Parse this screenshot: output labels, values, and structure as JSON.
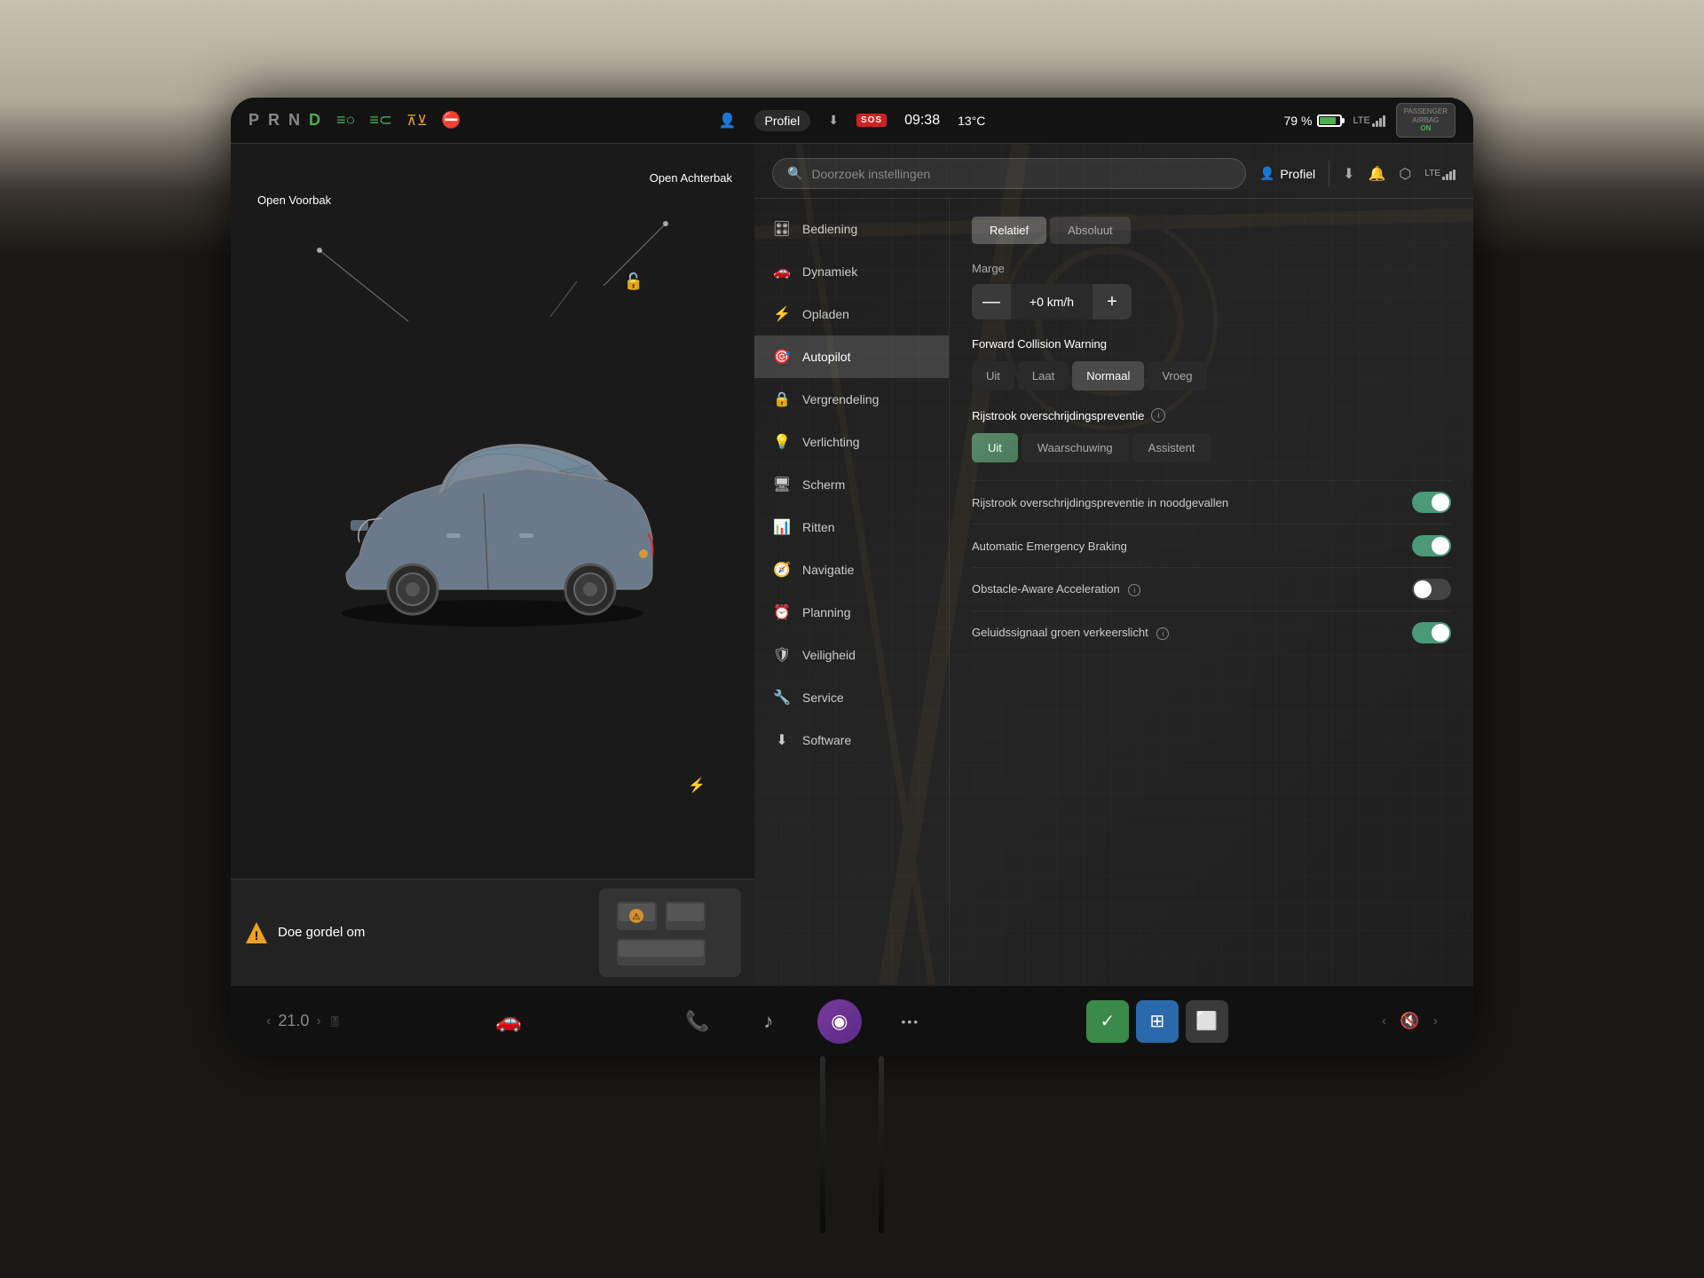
{
  "status_bar": {
    "prnd": {
      "p": "P",
      "r": "R",
      "n": "N",
      "d": "D"
    },
    "battery_pct": "79 %",
    "time": "09:38",
    "temp": "13°C",
    "profile_label": "Profiel",
    "sos_label": "SOS",
    "airbag_label": "PASSENGER\nAIRBAG ON"
  },
  "left_panel": {
    "car_labels": {
      "open_voorbak": "Open\nVoorbak",
      "open_achterbak": "Open\nAchterbak"
    },
    "warning": {
      "text": "Doe gordel om"
    }
  },
  "right_panel": {
    "search_placeholder": "Doorzoek instellingen",
    "profile_label": "Profiel",
    "nav_items": [
      {
        "id": "bediening",
        "label": "Bediening",
        "icon": "🎛"
      },
      {
        "id": "dynamiek",
        "label": "Dynamiek",
        "icon": "🚗"
      },
      {
        "id": "opladen",
        "label": "Opladen",
        "icon": "⚡"
      },
      {
        "id": "autopilot",
        "label": "Autopilot",
        "icon": "🎯",
        "active": true
      },
      {
        "id": "vergrendeling",
        "label": "Vergrendeling",
        "icon": "🔒"
      },
      {
        "id": "verlichting",
        "label": "Verlichting",
        "icon": "💡"
      },
      {
        "id": "scherm",
        "label": "Scherm",
        "icon": "🖥"
      },
      {
        "id": "ritten",
        "label": "Ritten",
        "icon": "📊"
      },
      {
        "id": "navigatie",
        "label": "Navigatie",
        "icon": "🧭"
      },
      {
        "id": "planning",
        "label": "Planning",
        "icon": "⏰"
      },
      {
        "id": "veiligheid",
        "label": "Veiligheid",
        "icon": "🛡"
      },
      {
        "id": "service",
        "label": "Service",
        "icon": "🔧"
      },
      {
        "id": "software",
        "label": "Software",
        "icon": "⬇"
      }
    ],
    "autopilot_settings": {
      "speed_mode": {
        "label_relatief": "Relatief",
        "label_absoluut": "Absoluut",
        "active": "relatief"
      },
      "marge": {
        "label": "Marge",
        "value": "+0 km/h",
        "minus": "—",
        "plus": "+"
      },
      "forward_collision": {
        "title": "Forward Collision Warning",
        "options": [
          "Uit",
          "Laat",
          "Normaal",
          "Vroeg"
        ],
        "active": "Normaal"
      },
      "lane_departure": {
        "title": "Rijstrook overschrijdingspreventie",
        "options": [
          "Uit",
          "Waarschuwing",
          "Assistent"
        ],
        "active": "Uit"
      },
      "toggles": [
        {
          "id": "rijstrook_noodgevallen",
          "label": "Rijstrook overschrijdingspreventie in noodgevallen",
          "enabled": true
        },
        {
          "id": "emergency_braking",
          "label": "Automatic Emergency Braking",
          "enabled": true
        },
        {
          "id": "obstacle_aware",
          "label": "Obstacle-Aware Acceleration",
          "enabled": false,
          "has_info": true
        },
        {
          "id": "geluidssignaal",
          "label": "Geluidssignaal groen verkeerslicht",
          "enabled": true,
          "has_info": true
        }
      ]
    }
  },
  "taskbar": {
    "temp_left_arrow": "‹",
    "temp_value": "21.0",
    "temp_right_arrow": "›",
    "buttons": [
      {
        "id": "phone",
        "icon": "📞",
        "label": "Telefoon"
      },
      {
        "id": "music",
        "icon": "♪",
        "label": "Muziek"
      },
      {
        "id": "voice",
        "icon": "◉",
        "label": "Spraak"
      },
      {
        "id": "more",
        "icon": "•••",
        "label": "Meer"
      }
    ],
    "app_icons": [
      {
        "id": "checklist",
        "color": "green",
        "icon": "✓"
      },
      {
        "id": "map",
        "color": "blue",
        "icon": "⊞"
      },
      {
        "id": "window",
        "color": "gray",
        "icon": "⬜"
      }
    ],
    "volume": {
      "left_arrow": "‹",
      "icon": "🔊",
      "right_arrow": "›"
    },
    "car_icon": "🚗"
  }
}
